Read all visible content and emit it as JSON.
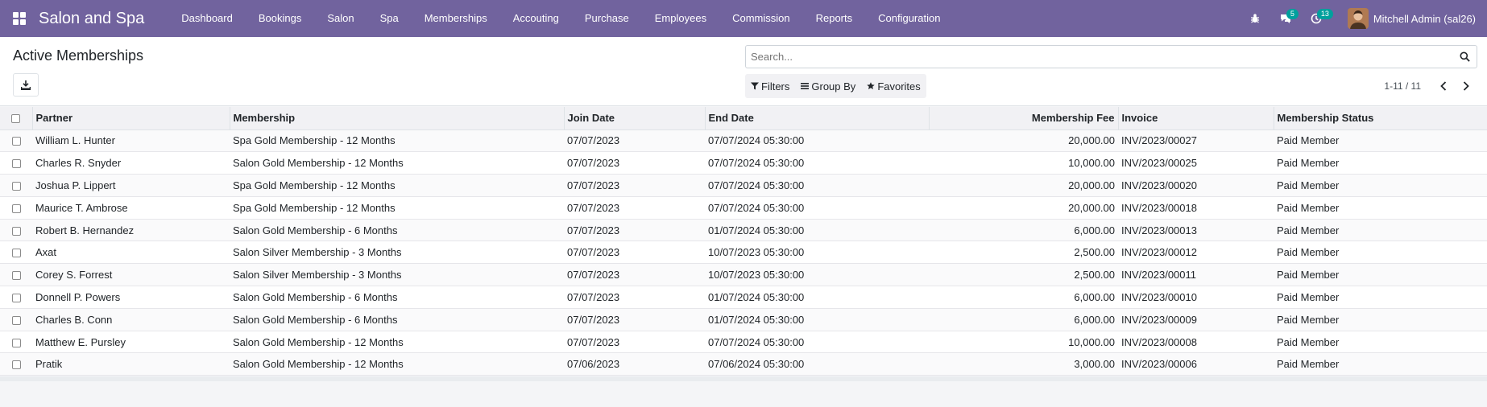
{
  "navbar": {
    "app_name": "Salon and Spa",
    "menu": [
      "Dashboard",
      "Bookings",
      "Salon",
      "Spa",
      "Memberships",
      "Accouting",
      "Purchase",
      "Employees",
      "Commission",
      "Reports",
      "Configuration"
    ],
    "messages_count": "5",
    "activities_count": "13",
    "user_name": "Mitchell Admin (sal26)",
    "accent_color": "#71639e",
    "badge_color": "#00a09d"
  },
  "control": {
    "title": "Active Memberships",
    "search_placeholder": "Search...",
    "filters_label": "Filters",
    "groupby_label": "Group By",
    "favorites_label": "Favorites",
    "pager_value": "1-11 / 11"
  },
  "table": {
    "headers": {
      "partner": "Partner",
      "membership": "Membership",
      "join_date": "Join Date",
      "end_date": "End Date",
      "fee": "Membership Fee",
      "invoice": "Invoice",
      "status": "Membership Status"
    },
    "rows": [
      {
        "partner": "William L. Hunter",
        "membership": "Spa Gold Membership - 12 Months",
        "join_date": "07/07/2023",
        "end_date": "07/07/2024 05:30:00",
        "fee": "20,000.00",
        "invoice": "INV/2023/00027",
        "status": "Paid Member"
      },
      {
        "partner": "Charles R. Snyder",
        "membership": "Salon Gold Membership - 12 Months",
        "join_date": "07/07/2023",
        "end_date": "07/07/2024 05:30:00",
        "fee": "10,000.00",
        "invoice": "INV/2023/00025",
        "status": "Paid Member"
      },
      {
        "partner": "Joshua P. Lippert",
        "membership": "Spa Gold Membership - 12 Months",
        "join_date": "07/07/2023",
        "end_date": "07/07/2024 05:30:00",
        "fee": "20,000.00",
        "invoice": "INV/2023/00020",
        "status": "Paid Member"
      },
      {
        "partner": "Maurice T. Ambrose",
        "membership": "Spa Gold Membership - 12 Months",
        "join_date": "07/07/2023",
        "end_date": "07/07/2024 05:30:00",
        "fee": "20,000.00",
        "invoice": "INV/2023/00018",
        "status": "Paid Member"
      },
      {
        "partner": "Robert B. Hernandez",
        "membership": "Salon Gold Membership - 6 Months",
        "join_date": "07/07/2023",
        "end_date": "01/07/2024 05:30:00",
        "fee": "6,000.00",
        "invoice": "INV/2023/00013",
        "status": "Paid Member"
      },
      {
        "partner": "Axat",
        "membership": "Salon Silver Membership - 3 Months",
        "join_date": "07/07/2023",
        "end_date": "10/07/2023 05:30:00",
        "fee": "2,500.00",
        "invoice": "INV/2023/00012",
        "status": "Paid Member"
      },
      {
        "partner": "Corey S. Forrest",
        "membership": "Salon Silver Membership - 3 Months",
        "join_date": "07/07/2023",
        "end_date": "10/07/2023 05:30:00",
        "fee": "2,500.00",
        "invoice": "INV/2023/00011",
        "status": "Paid Member"
      },
      {
        "partner": "Donnell P. Powers",
        "membership": "Salon Gold Membership - 6 Months",
        "join_date": "07/07/2023",
        "end_date": "01/07/2024 05:30:00",
        "fee": "6,000.00",
        "invoice": "INV/2023/00010",
        "status": "Paid Member"
      },
      {
        "partner": "Charles B. Conn",
        "membership": "Salon Gold Membership - 6 Months",
        "join_date": "07/07/2023",
        "end_date": "01/07/2024 05:30:00",
        "fee": "6,000.00",
        "invoice": "INV/2023/00009",
        "status": "Paid Member"
      },
      {
        "partner": "Matthew E. Pursley",
        "membership": "Salon Gold Membership - 12 Months",
        "join_date": "07/07/2023",
        "end_date": "07/07/2024 05:30:00",
        "fee": "10,000.00",
        "invoice": "INV/2023/00008",
        "status": "Paid Member"
      },
      {
        "partner": "Pratik",
        "membership": "Salon Gold Membership - 12 Months",
        "join_date": "07/06/2023",
        "end_date": "07/06/2024 05:30:00",
        "fee": "3,000.00",
        "invoice": "INV/2023/00006",
        "status": "Paid Member"
      }
    ]
  }
}
